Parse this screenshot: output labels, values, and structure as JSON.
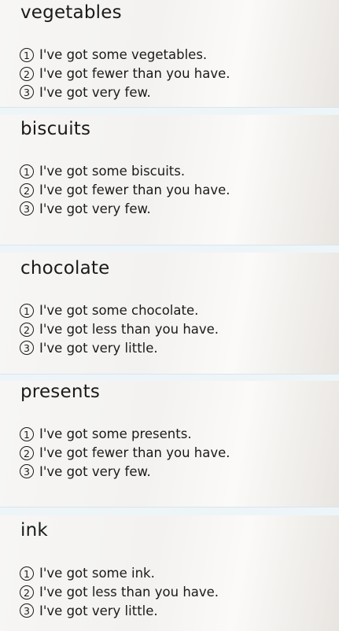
{
  "cards": [
    {
      "title": "vegetables",
      "options": [
        {
          "num": "1",
          "text": "I've got some vegetables."
        },
        {
          "num": "2",
          "text": "I've got fewer than you have."
        },
        {
          "num": "3",
          "text": "I've got very few."
        }
      ]
    },
    {
      "title": "biscuits",
      "options": [
        {
          "num": "1",
          "text": "I've got some biscuits."
        },
        {
          "num": "2",
          "text": "I've got fewer than you have."
        },
        {
          "num": "3",
          "text": "I've got very few."
        }
      ]
    },
    {
      "title": "chocolate",
      "options": [
        {
          "num": "1",
          "text": "I've got some chocolate."
        },
        {
          "num": "2",
          "text": "I've got less than you have."
        },
        {
          "num": "3",
          "text": "I've got very little."
        }
      ]
    },
    {
      "title": "presents",
      "options": [
        {
          "num": "1",
          "text": "I've got some presents."
        },
        {
          "num": "2",
          "text": "I've got fewer than you have."
        },
        {
          "num": "3",
          "text": "I've got very few."
        }
      ]
    },
    {
      "title": "ink",
      "options": [
        {
          "num": "1",
          "text": "I've got some ink."
        },
        {
          "num": "2",
          "text": "I've got less than you have."
        },
        {
          "num": "3",
          "text": "I've got very little."
        }
      ]
    }
  ]
}
